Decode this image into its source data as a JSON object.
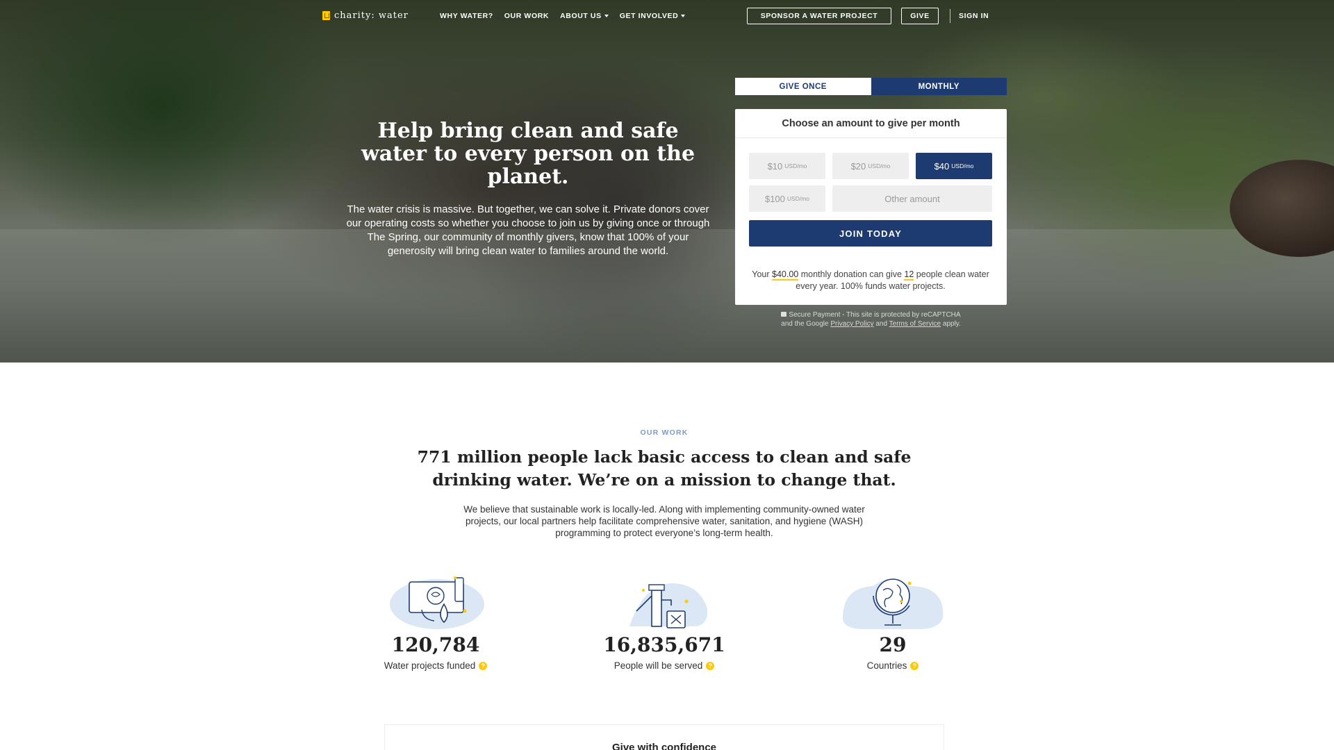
{
  "nav": {
    "logo_text": "charity: water",
    "links": [
      {
        "label": "WHY WATER?",
        "dropdown": false
      },
      {
        "label": "OUR WORK",
        "dropdown": false
      },
      {
        "label": "ABOUT US",
        "dropdown": true
      },
      {
        "label": "GET INVOLVED",
        "dropdown": true
      }
    ],
    "sponsor_label": "SPONSOR A WATER PROJECT",
    "give_label": "GIVE",
    "signin_label": "SIGN IN"
  },
  "hero": {
    "title": "Help bring clean and safe water to every person on the planet.",
    "body": "The water crisis is massive. But together, we can solve it. Private donors cover our operating costs so whether you choose to join us by giving once or through The Spring, our community of monthly givers, know that 100% of your generosity will bring clean water to families around the world."
  },
  "donate": {
    "tabs": {
      "once": "GIVE ONCE",
      "monthly": "MONTHLY"
    },
    "active_tab": "monthly",
    "heading": "Choose an amount to give per month",
    "amounts": [
      {
        "value": "$10",
        "unit": "USD/mo",
        "selected": false
      },
      {
        "value": "$20",
        "unit": "USD/mo",
        "selected": false
      },
      {
        "value": "$40",
        "unit": "USD/mo",
        "selected": true
      },
      {
        "value": "$100",
        "unit": "USD/mo",
        "selected": false
      }
    ],
    "other_placeholder": "Other amount",
    "join_label": "JOIN TODAY",
    "impact": {
      "pre": "Your ",
      "amount": "$40.00",
      "mid": " monthly donation can give ",
      "people": "12",
      "post": " people clean water every year. 100% funds water projects."
    },
    "secure": {
      "line1": "Secure Payment - This site is protected by reCAPTCHA",
      "line2_pre": "and the Google ",
      "privacy": "Privacy Policy",
      "and": " and ",
      "terms": "Terms of Service",
      "apply": " apply."
    }
  },
  "our_work": {
    "eyebrow": "OUR WORK",
    "title": "771 million people lack basic access to clean and safe drinking water. We’re on a mission to change that.",
    "body": "We believe that sustainable work is locally-led. Along with implementing community-owned water projects, our local partners help facilitate comprehensive water, sanitation, and hygiene (WASH) programming to protect everyone’s long-term health."
  },
  "stats": [
    {
      "number": "120,784",
      "label": "Water projects funded",
      "icon": "water-projects-icon"
    },
    {
      "number": "16,835,671",
      "label": "People will be served",
      "icon": "water-pump-icon"
    },
    {
      "number": "29",
      "label": "Countries",
      "icon": "globe-icon"
    }
  ],
  "confidence": {
    "title": "Give with confidence"
  },
  "colors": {
    "navy": "#1d3b70",
    "yellow": "#ffc907",
    "eyebrow": "#7a9cc6"
  }
}
